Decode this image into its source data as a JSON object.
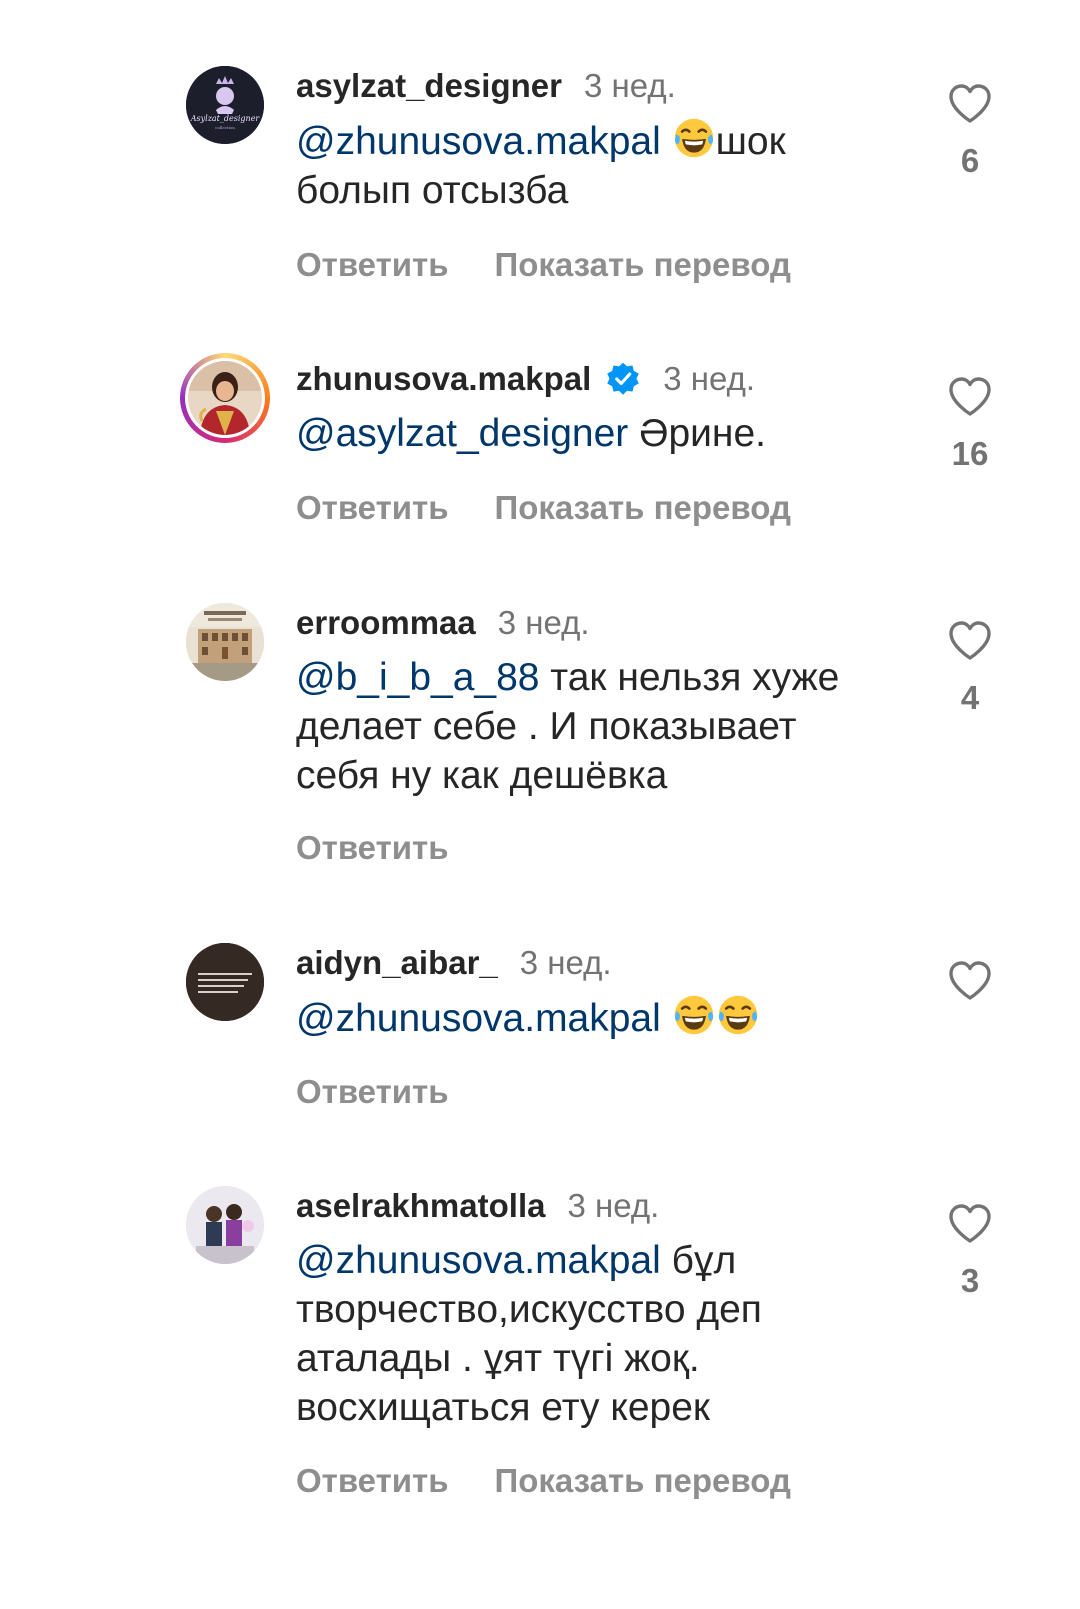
{
  "comments": [
    {
      "username": "asylzat_designer",
      "time": "3 нед.",
      "mention": "@zhunusova.makpal",
      "text_after_emoji": "шок болып отсызба",
      "reply_label": "Ответить",
      "translate_label": "Показать перевод",
      "likes": "6",
      "avatar_text": "Asylzat_designer"
    },
    {
      "username": "zhunusova.makpal",
      "time": "3 нед.",
      "mention": "@asylzat_designer",
      "text": " Әрине.",
      "reply_label": "Ответить",
      "translate_label": "Показать перевод",
      "likes": "16"
    },
    {
      "username": "erroommaa",
      "time": "3 нед.",
      "mention": "@b_i_b_a_88",
      "text": " так нельзя хуже делает себе . И показывает себя ну как дешёвка",
      "reply_label": "Ответить",
      "likes": "4"
    },
    {
      "username": "aidyn_aibar_",
      "time": "3 нед.",
      "mention": "@zhunusova.makpal",
      "reply_label": "Ответить",
      "likes": ""
    },
    {
      "username": "aselrakhmatolla",
      "time": "3 нед.",
      "mention": "@zhunusova.makpal",
      "text": " бұл творчество,искусство деп аталады . ұят түгі жоқ. восхищаться ету керек",
      "reply_label": "Ответить",
      "translate_label": "Показать перевод",
      "likes": "3"
    }
  ],
  "colors": {
    "text": "#262626",
    "secondary": "#737373",
    "action": "#8e8e8e",
    "mention": "#00376b",
    "verified": "#0095f6"
  },
  "icons": [
    "heart-outline-icon",
    "verified-badge-icon",
    "tears-of-joy-emoji"
  ]
}
